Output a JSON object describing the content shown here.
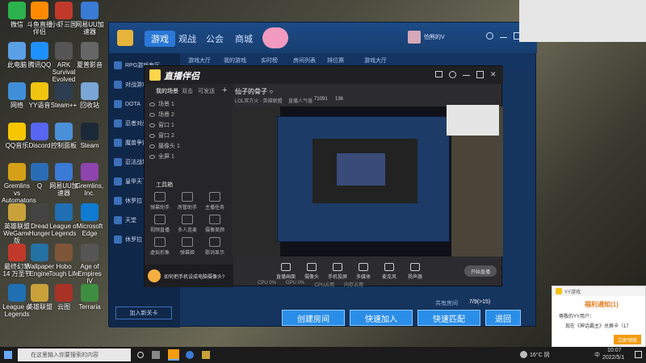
{
  "desktop_icons": [
    {
      "label": "微信",
      "icon": "wechat-icon",
      "color": "#2bb24c"
    },
    {
      "label": "斗鱼直播伴侣",
      "icon": "douyu-icon",
      "color": "#ff8a00"
    },
    {
      "label": "小虾三国",
      "icon": "game-icon",
      "color": "#c0392b"
    },
    {
      "label": "网易UU加速器",
      "icon": "uu-icon",
      "color": "#3a7bd5"
    },
    {
      "label": "此电脑",
      "icon": "computer-icon",
      "color": "#5aa0e6"
    },
    {
      "label": "腾讯QQ",
      "icon": "qq-icon",
      "color": "#1e90ff"
    },
    {
      "label": "ARK Survival Evolved",
      "icon": "ark-icon",
      "color": "#555"
    },
    {
      "label": "夏普影音",
      "icon": "video-icon",
      "color": "#666"
    },
    {
      "label": "网络",
      "icon": "network-icon",
      "color": "#3f8fd8"
    },
    {
      "label": "YY语音",
      "icon": "yy-icon",
      "color": "#f1c40f"
    },
    {
      "label": "Steam++",
      "icon": "steampp-icon",
      "color": "#2c3e50"
    },
    {
      "label": "回收站",
      "icon": "recycle-bin-icon",
      "color": "#7aa6d6"
    },
    {
      "label": "QQ音乐",
      "icon": "qqmusic-icon",
      "color": "#f7c600"
    },
    {
      "label": "Discord",
      "icon": "discord-icon",
      "color": "#5865f2"
    },
    {
      "label": "控制面板",
      "icon": "control-panel-icon",
      "color": "#4a90d9"
    },
    {
      "label": "Steam",
      "icon": "steam-icon",
      "color": "#1b2838"
    },
    {
      "label": "Gremlins vs Automatons",
      "icon": "gremlins-icon",
      "color": "#d4a017"
    },
    {
      "label": "Q",
      "icon": "q-icon",
      "color": "#2a6db5"
    },
    {
      "label": "网易UU加速器",
      "icon": "uu2-icon",
      "color": "#3a7bd5"
    },
    {
      "label": "Gremlins, Inc.",
      "icon": "gremlins-inc-icon",
      "color": "#8e44ad"
    },
    {
      "label": "英雄联盟WeGame版",
      "icon": "lol-icon",
      "color": "#c9a13b"
    },
    {
      "label": "Dread Hunger",
      "icon": "dread-hunger-icon",
      "color": "#444"
    },
    {
      "label": "League of Legends",
      "icon": "lol2-icon",
      "color": "#1f6fb2"
    },
    {
      "label": "Microsoft Edge",
      "icon": "edge-icon",
      "color": "#0f7bd0"
    },
    {
      "label": "最终幻想14 万圣节",
      "icon": "ff14-icon",
      "color": "#c0392b"
    },
    {
      "label": "Wallpaper Engine",
      "icon": "wallpaper-icon",
      "color": "#2471a3"
    },
    {
      "label": "Hobo Tough Life",
      "icon": "hobo-icon",
      "color": "#7f5539"
    },
    {
      "label": "Age of Empires IV",
      "icon": "aoe-icon",
      "color": "#555"
    },
    {
      "label": "League of Legends",
      "icon": "lol3-icon",
      "color": "#1f6fb2"
    },
    {
      "label": "英雄联盟",
      "icon": "lol4-icon",
      "color": "#c9a13b"
    },
    {
      "label": "云图",
      "icon": "cloud-icon",
      "color": "#a93226"
    },
    {
      "label": "Terraria",
      "icon": "terraria-icon",
      "color": "#3e8e41"
    }
  ],
  "yy_window": {
    "tabs": [
      "游戏",
      "观战",
      "公会",
      "商城"
    ],
    "sub_tabs": [
      "游戏大厅",
      "我的游戏",
      "实时榜",
      "房间列表",
      "排位赛",
      "游戏大厅"
    ],
    "sidebar": [
      "RPG游戏专区",
      "对战游戏",
      "DOTA",
      "忍者对战",
      "魔兽争霸",
      "忍法战场",
      "皇甲天下",
      "休罗拉",
      "天堂",
      "休罗拉"
    ],
    "add_friend": "加入新关卡",
    "user_name": "怕熊的V",
    "buttons": {
      "create": "创建房间",
      "quick_join": "快速加入",
      "quick_match": "快速匹配",
      "back": "退回"
    },
    "status_text": "共有房间",
    "count_text": "7/9(>15)"
  },
  "live_window": {
    "title": "直播伴侣",
    "scene_tabs": [
      "我的场景",
      "双击",
      "可发送"
    ],
    "scenes": [
      "场景 1",
      "场景 2",
      "窗口 1",
      "窗口 2",
      "摄像头 1",
      "全屏 1"
    ],
    "toolbar_title": "工具箱",
    "tools": [
      "弹幕助手",
      "房管助手",
      "主播任务",
      "视频直播",
      "多人连麦",
      "摄像美颜",
      "虚拟形象",
      "弹幕姬",
      "歌词显示"
    ],
    "room_title": "仙子的骨子 ○",
    "room_tags": [
      "LOL官方火 · 英雄联盟",
      "直播人气值"
    ],
    "room_stats": [
      "71091",
      "136"
    ],
    "controls": [
      "直播画面",
      "摄像头",
      "手机投屏",
      "多媒体",
      "麦克风",
      "扬声器"
    ],
    "start_button": "开始直播",
    "hint": "如何把手机设成电脑摄像头?",
    "status_items": [
      "CPU 0%",
      "GPU 0%",
      "CPU占用",
      "内存占用"
    ]
  },
  "notice": {
    "app": "YY游戏",
    "title": "福利通知(1)",
    "line1": "尊敬的YY用户：",
    "line2": "现在《神话霸主》兑换卡（17",
    "button": "立即领取"
  },
  "taskbar": {
    "search_placeholder": "在这里输入你要搜索的内容",
    "weather": "16°C 阴",
    "ime": "中",
    "time": "10:07",
    "date": "2022/5/1"
  }
}
